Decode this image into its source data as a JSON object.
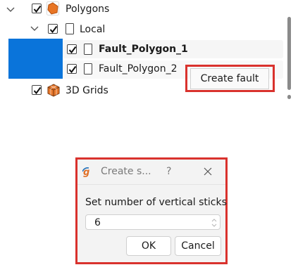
{
  "tree": {
    "items": [
      {
        "label": "Polygons",
        "checked": true,
        "expanded": true,
        "icon": "polygon-orange-icon"
      },
      {
        "label": "Local",
        "checked": true,
        "expanded": true,
        "icon": "document-icon"
      },
      {
        "label": "Fault_Polygon_1",
        "checked": true,
        "bold": true,
        "icon": "document-icon",
        "selected": true
      },
      {
        "label": "Fault_Polygon_2",
        "checked": true,
        "icon": "document-icon"
      },
      {
        "label": "3D Grids",
        "checked": true,
        "icon": "grid-3d-icon"
      }
    ]
  },
  "context_menu": {
    "create_fault_label": "Create fault"
  },
  "dialog": {
    "title": "Create s...",
    "help_icon": "?",
    "close_icon": "close-icon",
    "prompt": "Set number of vertical sticks",
    "sticks_value": "6",
    "ok_label": "OK",
    "cancel_label": "Cancel"
  },
  "colors": {
    "accent_selection": "#0a74da",
    "annotation_red": "#d9322d"
  }
}
